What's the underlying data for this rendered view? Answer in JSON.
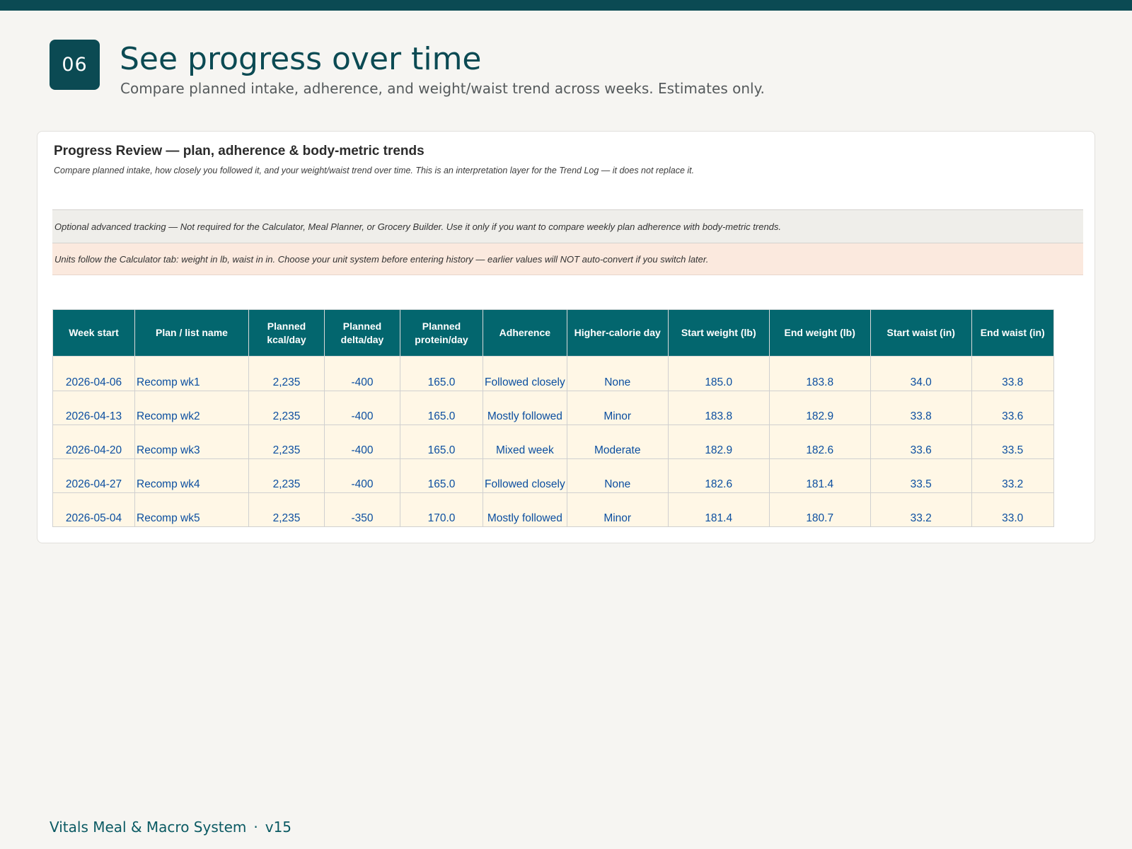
{
  "header": {
    "step_number": "06",
    "title": "See progress over time",
    "subtitle": "Compare planned intake, adherence, and weight/waist trend across weeks. Estimates only."
  },
  "card": {
    "title": "Progress Review — plan, adherence & body-metric trends",
    "description": "Compare planned intake, how closely you followed it, and your weight/waist trend over time. This is an interpretation layer for the Trend Log — it does not replace it.",
    "note_optional": "Optional advanced tracking — Not required for the Calculator, Meal Planner, or Grocery Builder. Use it only if you want to compare weekly plan adherence with body-metric trends.",
    "note_units": "Units follow the Calculator tab: weight in lb, waist in in. Choose your unit system before entering history — earlier values will NOT auto-convert if you switch later."
  },
  "table": {
    "headers": [
      "Week start",
      "Plan / list name",
      "Planned kcal/day",
      "Planned delta/day",
      "Planned protein/day",
      "Adherence",
      "Higher-calorie day",
      "Start weight (lb)",
      "End weight (lb)",
      "Start waist (in)",
      "End waist (in)"
    ],
    "rows": [
      [
        "2026-04-06",
        "Recomp wk1",
        "2,235",
        "-400",
        "165.0",
        "Followed closely",
        "None",
        "185.0",
        "183.8",
        "34.0",
        "33.8"
      ],
      [
        "2026-04-13",
        "Recomp wk2",
        "2,235",
        "-400",
        "165.0",
        "Mostly followed",
        "Minor",
        "183.8",
        "182.9",
        "33.8",
        "33.6"
      ],
      [
        "2026-04-20",
        "Recomp wk3",
        "2,235",
        "-400",
        "165.0",
        "Mixed week",
        "Moderate",
        "182.9",
        "182.6",
        "33.6",
        "33.5"
      ],
      [
        "2026-04-27",
        "Recomp wk4",
        "2,235",
        "-400",
        "165.0",
        "Followed closely",
        "None",
        "182.6",
        "181.4",
        "33.5",
        "33.2"
      ],
      [
        "2026-05-04",
        "Recomp wk5",
        "2,235",
        "-350",
        "170.0",
        "Mostly followed",
        "Minor",
        "181.4",
        "180.7",
        "33.2",
        "33.0"
      ]
    ]
  },
  "footer": {
    "product": "Vitals Meal & Macro System",
    "separator": "·",
    "version": "v15"
  },
  "colors": {
    "brand_dark": "#0b4a53",
    "header_teal": "#03666e",
    "input_cell": "#fff7e6",
    "input_text": "#0c4fa0",
    "units_note_bg": "#fbe9de"
  }
}
